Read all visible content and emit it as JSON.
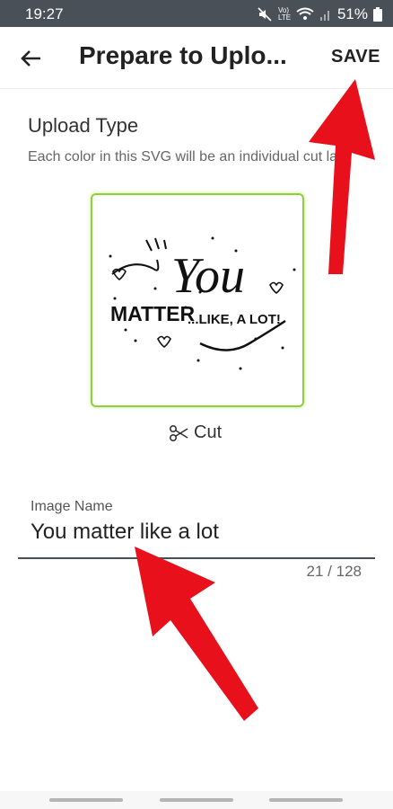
{
  "status": {
    "time": "19:27",
    "network": "Vo) LTE",
    "battery": "51%"
  },
  "appbar": {
    "title": "Prepare to Uplo...",
    "save_label": "SAVE"
  },
  "upload": {
    "title": "Upload Type",
    "subtitle": "Each color in this SVG will be an individual cut la",
    "cut_label": "Cut"
  },
  "preview": {
    "line1": "You",
    "line2": "MATTER",
    "line3": "...LIKE, A LOT!"
  },
  "image_name": {
    "label": "Image Name",
    "value": "You matter like a lot",
    "counter": "21 / 128"
  },
  "colors": {
    "accent_green": "#8fd13a",
    "arrow_red": "#e8111b",
    "statusbar": "#4a5057"
  }
}
